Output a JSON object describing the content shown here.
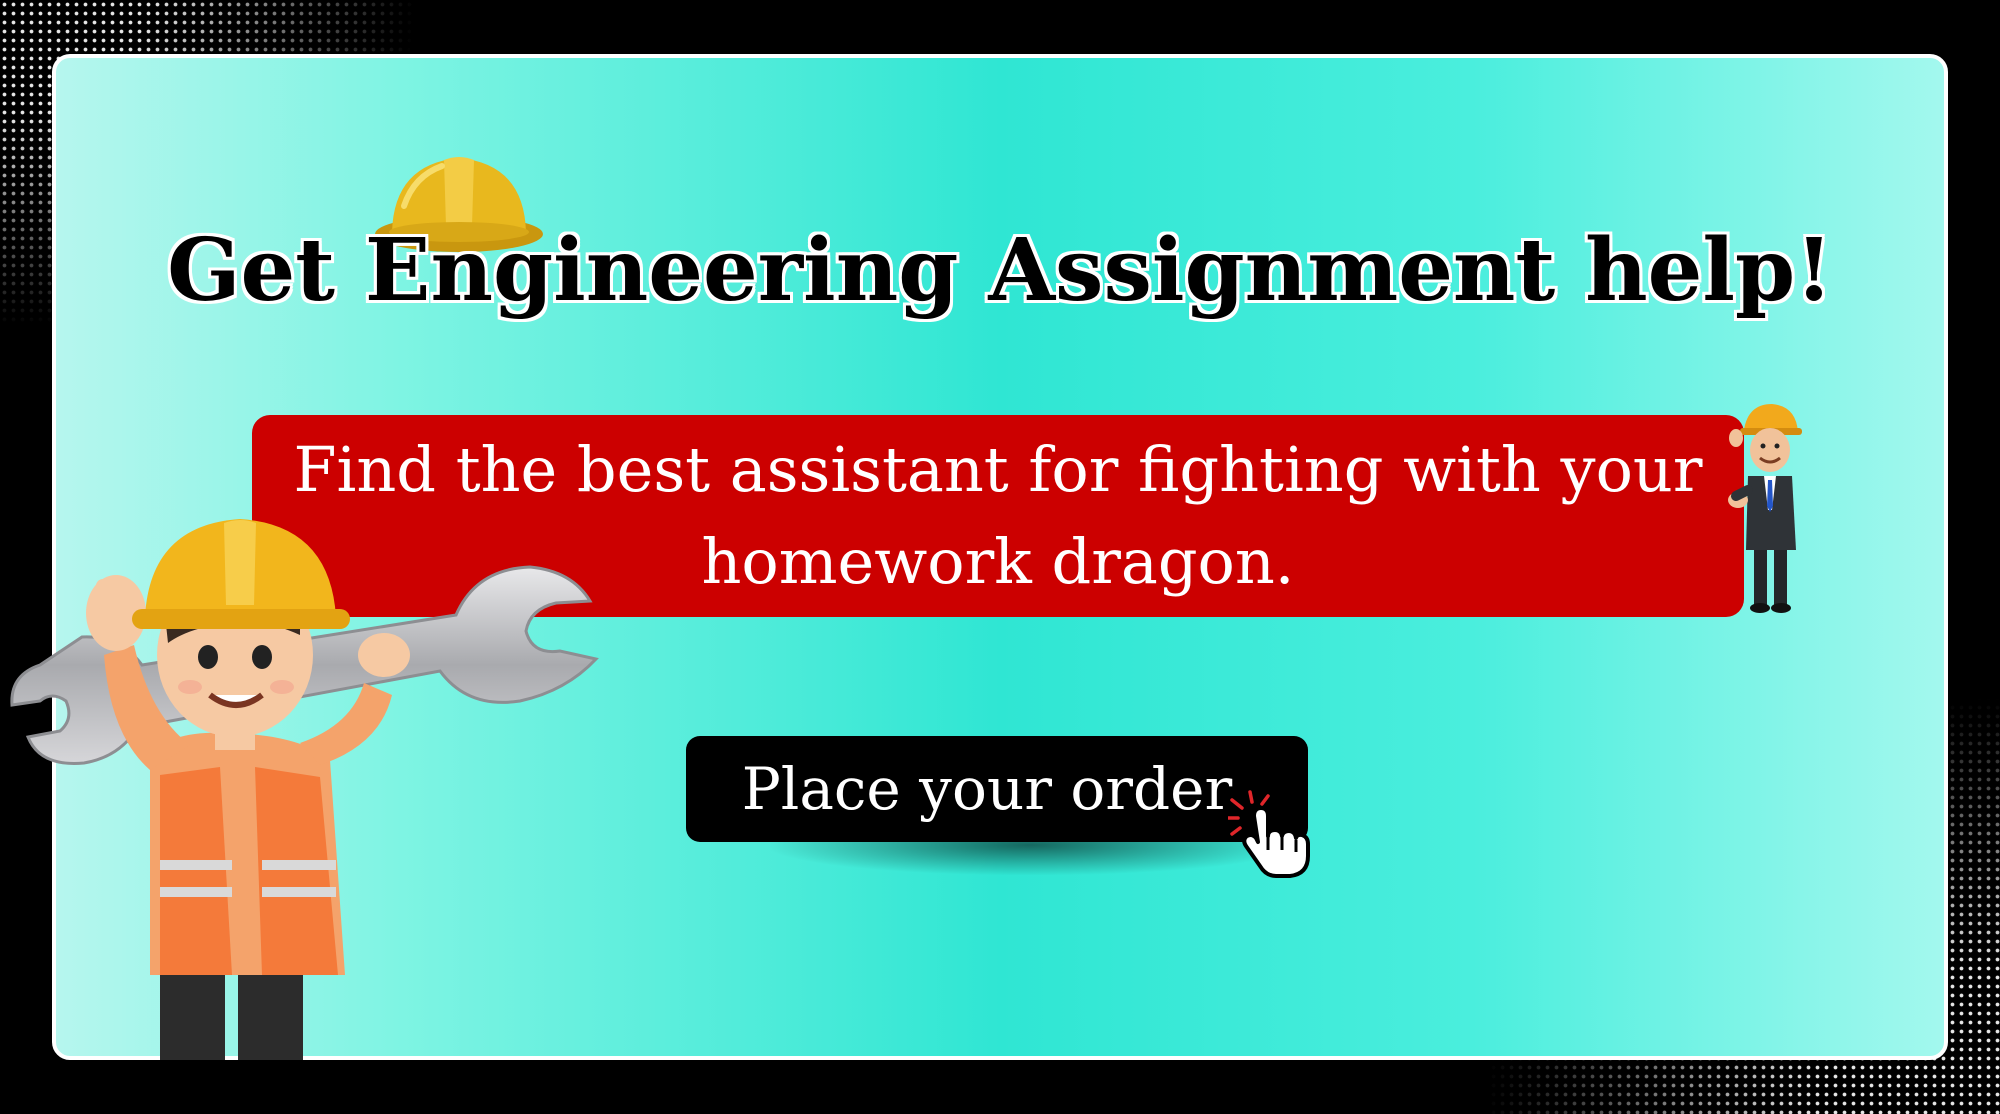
{
  "headline": "Get Engineering Assignment help!",
  "banner": {
    "text": "Find the best assistant for fighting with your homework dragon."
  },
  "cta": {
    "label": "Place your order"
  },
  "icons": {
    "hat": "hard-hat-icon",
    "pointer": "hand-pointer-icon",
    "worker": "construction-worker-illustration",
    "businessman": "businessman-illustration"
  },
  "colors": {
    "background_frame": "#000000",
    "card_teal": "#2fe6d3",
    "banner_red": "#cc0000",
    "button_black": "#000000",
    "text_white": "#ffffff",
    "hat_yellow": "#e8b81e",
    "vest_orange": "#f47a3a"
  }
}
